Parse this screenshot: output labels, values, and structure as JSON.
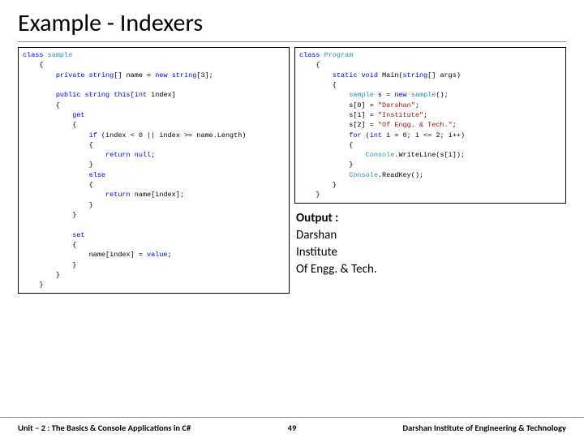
{
  "title": "Example - Indexers",
  "code_left": "<span class=\"kw\">class</span> <span class=\"typ\">sample</span>\n    {\n        <span class=\"kw\">private</span> <span class=\"kw\">string</span>[] name = <span class=\"kw\">new</span> <span class=\"kw\">string</span>[3];\n\n        <span class=\"kw\">public</span> <span class=\"kw\">string</span> <span class=\"kw\">this</span>[<span class=\"kw\">int</span> index]\n        {\n            <span class=\"kw\">get</span>\n            {\n                <span class=\"kw\">if</span> (index &lt; 0 || index &gt;= name.Length)\n                {\n                    <span class=\"kw\">return</span> <span class=\"kw\">null</span>;\n                }\n                <span class=\"kw\">else</span>\n                {\n                    <span class=\"kw\">return</span> name[index];\n                }\n            }\n\n            <span class=\"kw\">set</span>\n            {\n                name[index] = <span class=\"kw\">value</span>;\n            }\n        }\n    }",
  "code_right": "<span class=\"kw\">class</span> <span class=\"typ\">Program</span>\n    {\n        <span class=\"kw\">static</span> <span class=\"kw\">void</span> Main(<span class=\"kw\">string</span>[] args)\n        {\n            <span class=\"typ\">sample</span> s = <span class=\"kw\">new</span> <span class=\"typ\">sample</span>();\n            s[0] = <span class=\"str\">\"Darshan\"</span>;\n            s[1] = <span class=\"str\">\"Institute\"</span>;\n            s[2] = <span class=\"str\">\"Of Engg. &amp; Tech.\"</span>;\n            <span class=\"kw\">for</span> (<span class=\"kw\">int</span> i = 0; i &lt;= 2; i++)\n            {\n                <span class=\"typ\">Console</span>.WriteLine(s[i]);\n            }\n            <span class=\"typ\">Console</span>.ReadKey();\n        }\n    }",
  "output": {
    "label": "Output :",
    "lines": [
      "Darshan",
      "Institute",
      "Of Engg. & Tech."
    ]
  },
  "footer": {
    "unit": "Unit – 2 : The Basics & Console Applications in C#",
    "page": "49",
    "institute": "Darshan Institute of Engineering & Technology"
  }
}
